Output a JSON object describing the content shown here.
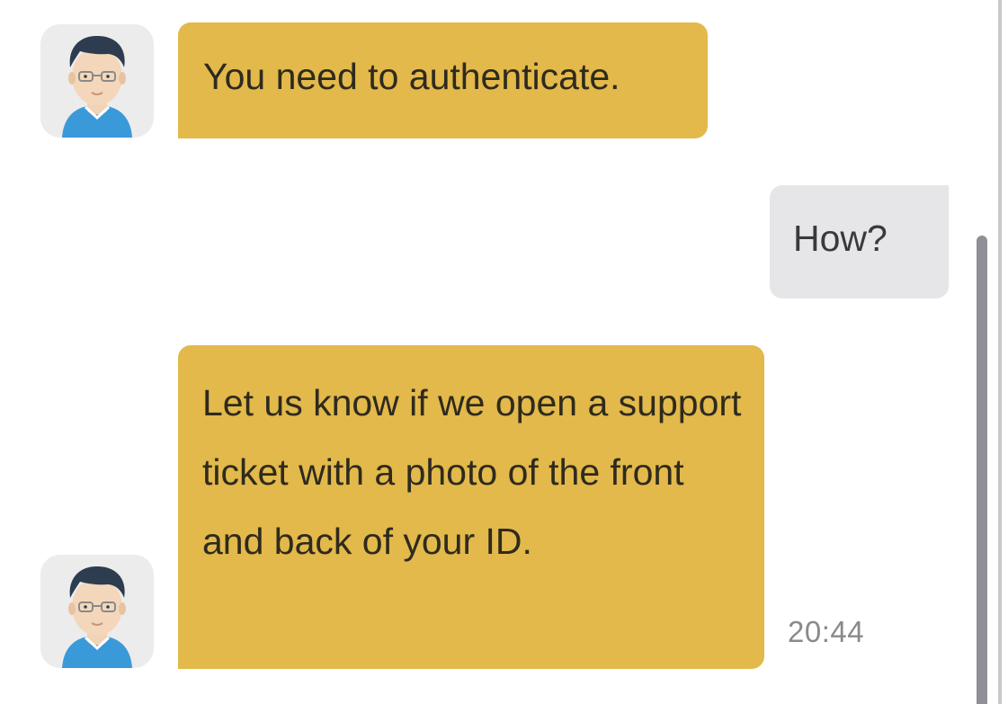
{
  "messages": [
    {
      "sender": "agent",
      "text": "You need to authenticate."
    },
    {
      "sender": "user",
      "text": "How?"
    },
    {
      "sender": "agent",
      "text": "Let us know if we open a support ticket with a photo of the front and back of your ID.",
      "time": "20:44"
    }
  ],
  "colors": {
    "agent_bubble": "#e2b94a",
    "user_bubble": "#e6e6e8",
    "avatar_bg": "#ececec",
    "timestamp": "#8a8a8a"
  },
  "icons": {
    "agent_avatar": "agent-avatar-icon"
  }
}
